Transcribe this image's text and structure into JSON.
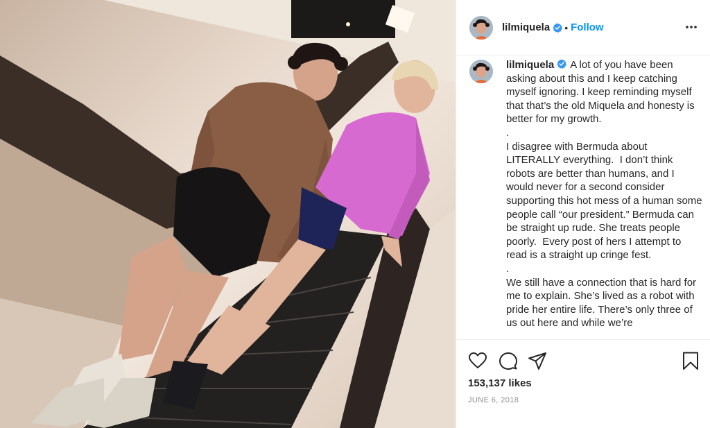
{
  "post": {
    "username": "lilmiquela",
    "separator": "•",
    "follow_label": "Follow",
    "caption": "A lot of you have been asking about this and I keep catching myself ignoring. I keep reminding myself that that’s the old Miquela and honesty is better for my growth.\n.\nI disagree with Bermuda about LITERALLY everything.  I don’t think robots are better than humans, and I would never for a second consider supporting this hot mess of a human some people call “our president.” Bermuda can be straight up rude. She treats people poorly.  Every post of hers I attempt to read is a straight up cringe fest.\n.\nWe still have a connection that is hard for me to explain. She’s lived as a robot with pride her entire life. There’s only three of us out here and while we’re",
    "likes": "153,137 likes",
    "date": "JUNE 6, 2018"
  },
  "icons": {
    "verified": "verified-badge-icon",
    "more": "more-options-icon",
    "like": "heart-icon",
    "comment": "comment-icon",
    "share": "paper-plane-icon",
    "save": "bookmark-icon"
  },
  "colors": {
    "link_blue": "#0095f6",
    "verified_blue": "#3897f0",
    "text": "#262626",
    "muted": "#8e8e8e",
    "border": "#efefef"
  }
}
